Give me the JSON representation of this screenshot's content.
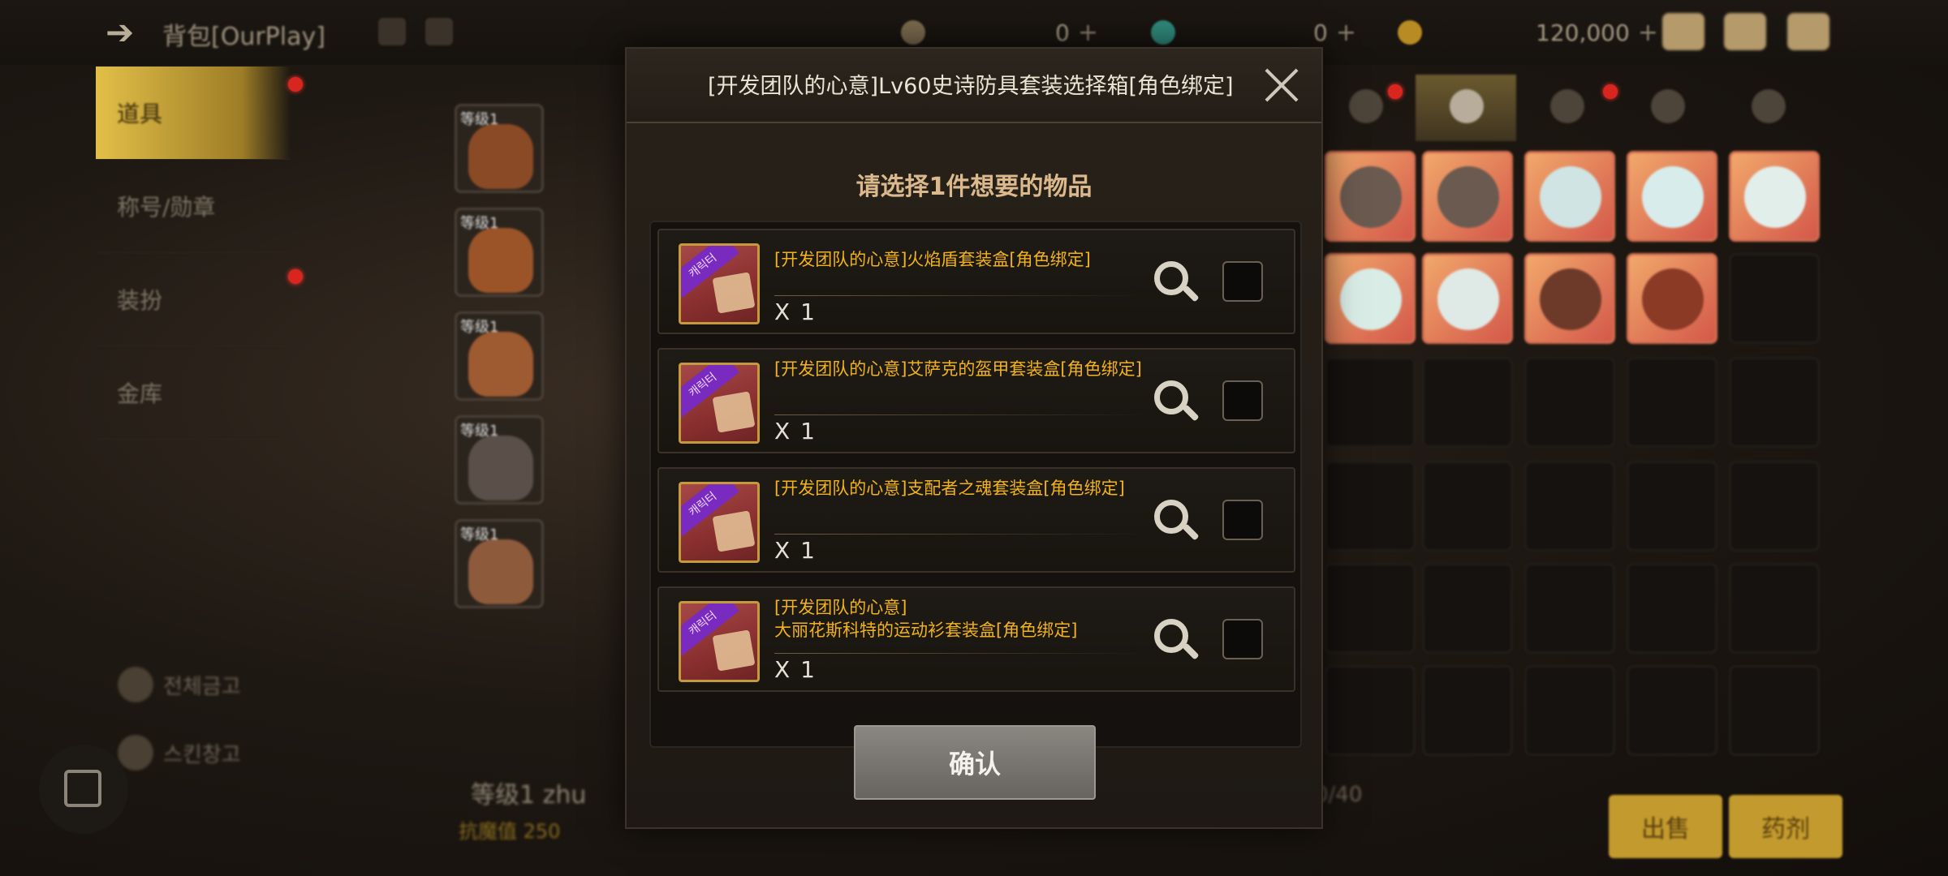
{
  "topbar": {
    "title": "背包[OurPlay]",
    "currency_1": "0",
    "currency_2": "0",
    "gold": "120,000",
    "plus": "+"
  },
  "sidebar": {
    "items": [
      {
        "label": "道具"
      },
      {
        "label": "称号/勋章"
      },
      {
        "label": "装扮"
      },
      {
        "label": "金库"
      }
    ],
    "bottom_1": "전체금고",
    "bottom_2": "스킨창고"
  },
  "equip_slots": {
    "tag": "等级1"
  },
  "character": {
    "level_text": "等级1 zhu",
    "resistance_label": "抗魔值 250",
    "capacity": "0/40"
  },
  "bottom_buttons": {
    "sell": "出售",
    "potion": "药剂"
  },
  "dialog": {
    "title": "[开发团队的心意]Lv60史诗防具套装选择箱[角色绑定]",
    "prompt": "请选择1件想要的物品",
    "confirm": "确认",
    "icon_ribbon": "캐릭터",
    "options": [
      {
        "name": "[开发团队的心意]火焰盾套装盒[角色绑定]",
        "qty": "X 1"
      },
      {
        "name": "[开发团队的心意]艾萨克的盔甲套装盒[角色绑定]",
        "qty": "X 1"
      },
      {
        "name": "[开发团队的心意]支配者之魂套装盒[角色绑定]",
        "qty": "X 1"
      },
      {
        "name": "[开发团队的心意]\n大丽花斯科特的运动衫套装盒[角色绑定]",
        "qty": "X 1"
      }
    ]
  },
  "colors": {
    "accent_gold": "#f2b21b",
    "prompt": "#dbb98d",
    "active_tab": "#e3bf48",
    "badge_red": "#d8261e"
  },
  "icons": [
    "back-arrow-icon",
    "close-icon",
    "magnifier-icon",
    "mail-icon",
    "chat-icon",
    "home-square-icon"
  ]
}
